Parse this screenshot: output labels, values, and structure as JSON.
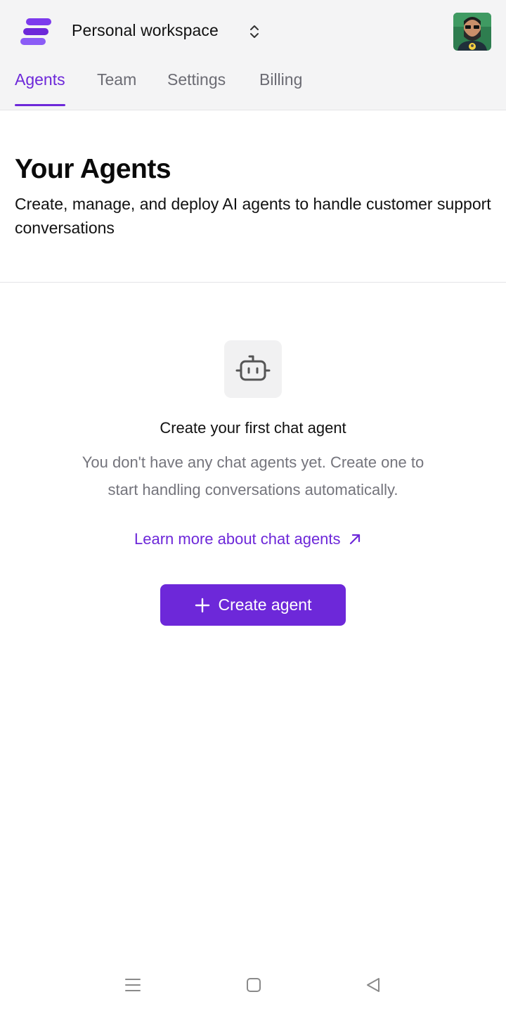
{
  "header": {
    "workspace_name": "Personal workspace",
    "icons": {
      "logo": "brand-logo",
      "switcher": "chevron-up-down-icon",
      "avatar": "user-avatar"
    }
  },
  "tabs": [
    {
      "label": "Agents",
      "active": true
    },
    {
      "label": "Team",
      "active": false
    },
    {
      "label": "Settings",
      "active": false
    },
    {
      "label": "Billing",
      "active": false
    }
  ],
  "page": {
    "title": "Your Agents",
    "subtitle": "Create, manage, and deploy AI agents to handle customer support conversations"
  },
  "empty_state": {
    "icon": "bot-icon",
    "title": "Create your first chat agent",
    "description": "You don't have any chat agents yet. Create one to start handling conversations automatically.",
    "learn_link": "Learn more about chat agents",
    "create_button": "Create agent"
  },
  "system_nav": {
    "icons": [
      "menu-icon",
      "home-square-icon",
      "back-triangle-icon"
    ]
  },
  "colors": {
    "accent": "#6d28d9",
    "topbar_bg": "#f4f4f5",
    "muted_text": "#74747c"
  }
}
